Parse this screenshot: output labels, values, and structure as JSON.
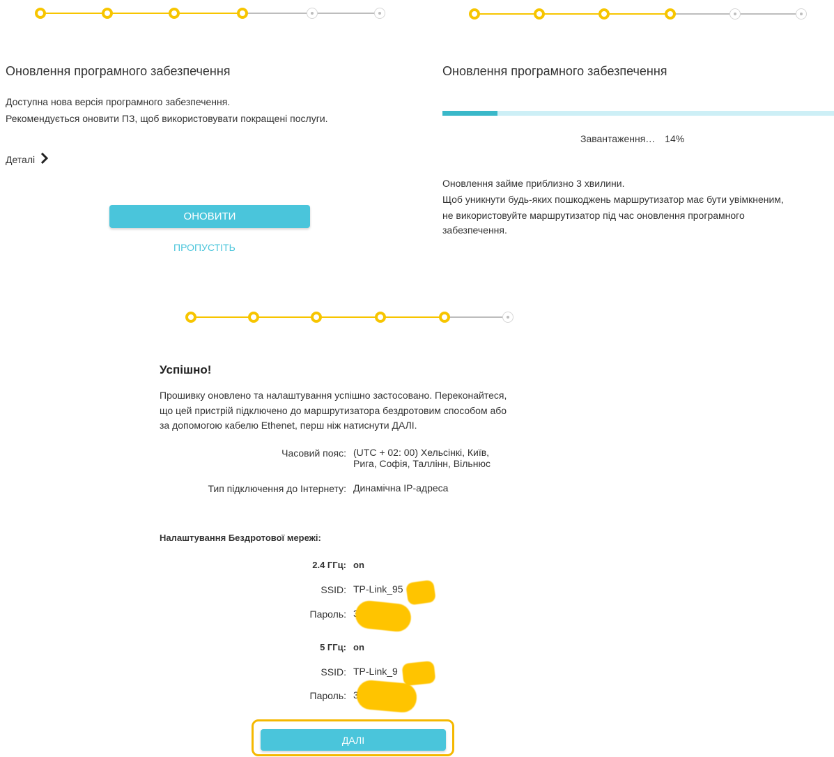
{
  "panel_left": {
    "title": "Оновлення програмного забезпечення",
    "line1": "Доступна нова версія програмного забезпечення.",
    "line2": "Рекомендується оновити ПЗ, щоб використовувати покращені послуги.",
    "details_label": "Деталі",
    "update_button": "ОНОВИТИ",
    "skip_link": "ПРОПУСТІТЬ"
  },
  "panel_right": {
    "title": "Оновлення програмного забезпечення",
    "loading_label": "Завантаження…",
    "loading_percent": "14%",
    "progress": 0.14,
    "note1": "Оновлення займе приблизно 3 хвилини.",
    "note2": "Щоб уникнути будь-яких пошкоджень маршрутизатор має бути увімкненим,",
    "note3": "не використовуйте маршрутизатор під час оновлення програмного",
    "note4": "забезпечення."
  },
  "panel_bottom": {
    "title": "Успішно!",
    "desc1": "Прошивку оновлено та налаштування успішно застосовано. Переконайтеся,",
    "desc2": "що цей пристрій підключено до маршрутизатора бездротовим способом або",
    "desc3": "за допомогою кабелю Ethenet, перш ніж натиснути ДАЛІ.",
    "timezone_label": "Часовий пояс:",
    "timezone_value1": "(UTC + 02: 00) Хельсінкі, Київ,",
    "timezone_value2": "Рига, Софія, Таллінн, Вільнюс",
    "conn_label": "Тип підключення до Інтернету:",
    "conn_value": "Динамічна IP-адреса",
    "wireless_heading": "Налаштування Бездротової мережі:",
    "band24_label": "2.4 ГГц:",
    "band24_value": "on",
    "ssid24_label": "SSID:",
    "ssid24_value": "TP-Link_95",
    "pass24_label": "Пароль:",
    "pass24_value": "3",
    "band5_label": "5 ГГц:",
    "band5_value": "on",
    "ssid5_label": "SSID:",
    "ssid5_value": "TP-Link_9",
    "pass5_label": "Пароль:",
    "pass5_value": "3",
    "next_button": "ДАЛІ"
  },
  "colors": {
    "accent": "#4ac5db",
    "step_done": "#f7c500",
    "step_todo": "#bdbdbd",
    "redaction": "#ffc400"
  }
}
